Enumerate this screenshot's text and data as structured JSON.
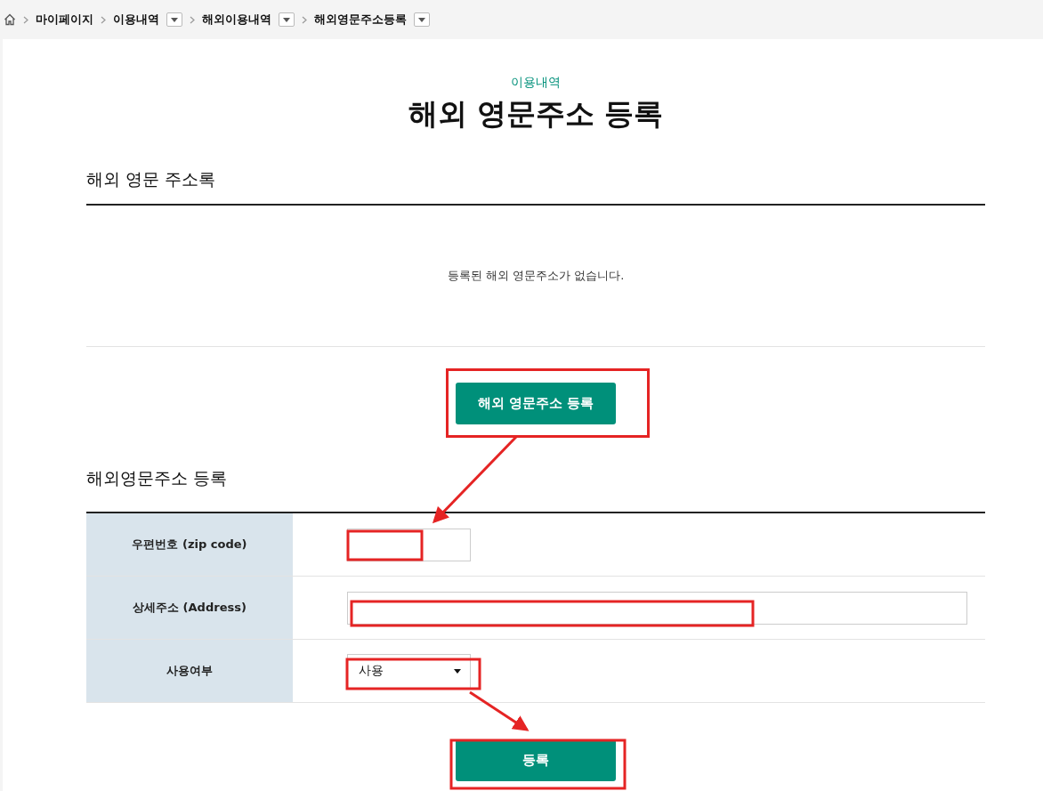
{
  "breadcrumb": [
    {
      "label": "마이페이지",
      "has_menu": false
    },
    {
      "label": "이용내역",
      "has_menu": true
    },
    {
      "label": "해외이용내역",
      "has_menu": true
    },
    {
      "label": "해외영문주소등록",
      "has_menu": true
    }
  ],
  "page": {
    "category": "이용내역",
    "title": "해외 영문주소 등록"
  },
  "address_book": {
    "heading": "해외 영문 주소록",
    "empty_message": "등록된 해외 영문주소가 없습니다.",
    "add_button": "해외 영문주소 등록"
  },
  "form": {
    "heading": "해외영문주소 등록",
    "rows": [
      {
        "kind": "short",
        "label": "우편번호 (zip code)",
        "value": ""
      },
      {
        "kind": "long",
        "label": "상세주소 (Address)",
        "value": ""
      },
      {
        "kind": "select",
        "label": "사용여부",
        "value": "사용"
      }
    ],
    "submit_button": "등록"
  }
}
